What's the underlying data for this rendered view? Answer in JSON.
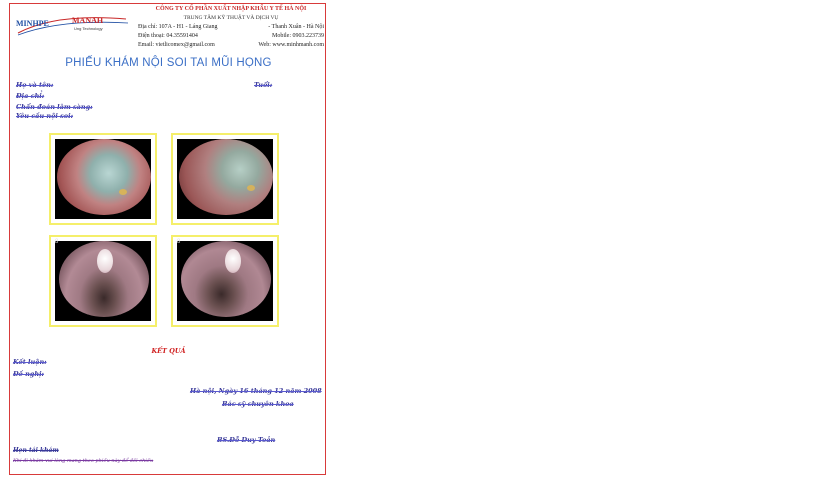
{
  "header": {
    "logo_left": "MINHPE",
    "logo_right": "MANAH",
    "logo_tagline": "Ung Technology",
    "company_name": "CÔNG TY CỔ PHẦN XUẤT NHẬP KHẨU Y TẾ HÀ NỘI",
    "company_sub": "TRUNG TÂM KỸ THUẬT VÀ DỊCH VỤ",
    "address_left": "Địa chỉ: 107A - H1 - Láng Giang",
    "address_right": "- Thanh Xuân - Hà Nội",
    "phone_left": "Điện thoại: 04.35591404",
    "phone_right": "Mobile: 0903.223739",
    "email_left": "Email: vietlicomex@gmail.com",
    "web_right": "Web: www.minhmanh.com"
  },
  "title": "PHIẾU KHÁM NỘI SOI TAI MŨI HỌNG",
  "fields": {
    "name_label": "Họ và tên:",
    "age_label": "Tuổi:",
    "address_label": "Địa chỉ:",
    "diagnosis_label": "Chẩn đoán lâm sàng:",
    "reason_label": "Yêu cầu nội soi:"
  },
  "images": [
    {
      "label": "",
      "kind": "ear-left"
    },
    {
      "label": "",
      "kind": "ear-right"
    },
    {
      "label": "8",
      "kind": "larynx"
    },
    {
      "label": "8",
      "kind": "larynx"
    }
  ],
  "result": {
    "heading": "KẾT QUẢ",
    "conclusion_label": "Kết luận:",
    "advice_label": "Đề nghị:"
  },
  "signature": {
    "date": "Hà nội, Ngày 16 tháng 12 năm 2008",
    "role": "Bác sỹ chuyên khoa",
    "doctor": "BS.Đỗ Duy Toản"
  },
  "footer": {
    "line1": "Hẹn tái khám",
    "line2": "Khi đi khám vui lòng mang theo phiếu này để đối chiếu"
  }
}
